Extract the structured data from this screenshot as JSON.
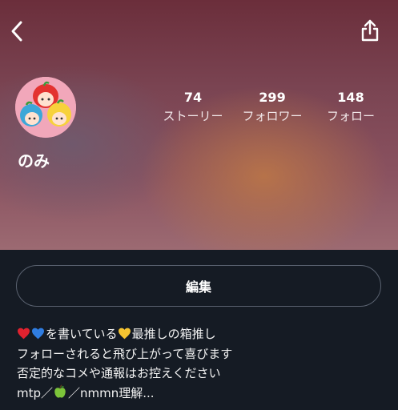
{
  "header": {
    "back_icon": "chevron-left-icon",
    "share_icon": "share-icon"
  },
  "profile": {
    "name": "のみ",
    "avatar": "avatar-illustration",
    "stats": [
      {
        "value": "74",
        "label": "ストーリー"
      },
      {
        "value": "299",
        "label": "フォロワー"
      },
      {
        "value": "148",
        "label": "フォロー"
      }
    ],
    "edit_label": "編集"
  },
  "bio": {
    "line1_text1": "を書いている",
    "line1_text2": "最推しの箱推し",
    "line2": "フォローされると飛び上がって喜びます",
    "line3": "否定的なコメや通報はお控えください",
    "line4_text1": "mtp／",
    "line4_text2": "／nmmn理解..."
  },
  "colors": {
    "accent_red_heart": "#e0222f",
    "accent_blue_heart": "#2f7de1",
    "accent_yellow_heart": "#f5c431",
    "bottom_bg": "#151b24"
  }
}
